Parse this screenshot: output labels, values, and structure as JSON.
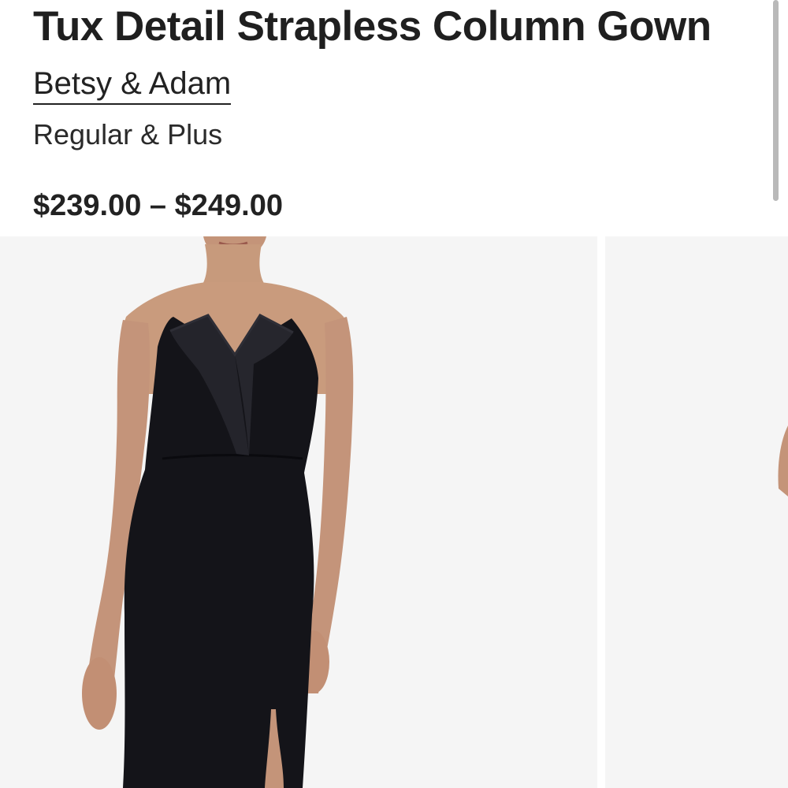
{
  "product": {
    "title": "Tux Detail Strapless Column Gown",
    "brand": "Betsy & Adam",
    "size_range": "Regular & Plus",
    "price": "$239.00 – $249.00"
  },
  "gallery": {
    "images": [
      {
        "alt": "Tux Detail Strapless Column Gown"
      },
      {
        "alt": "Tux Detail Strapless Column Gown"
      }
    ]
  },
  "colors": {
    "text": "#1f1f1f",
    "image_background": "#f5f5f5",
    "dress": "#141419",
    "lapel": "#23232a",
    "skin": "#c79a7c"
  }
}
